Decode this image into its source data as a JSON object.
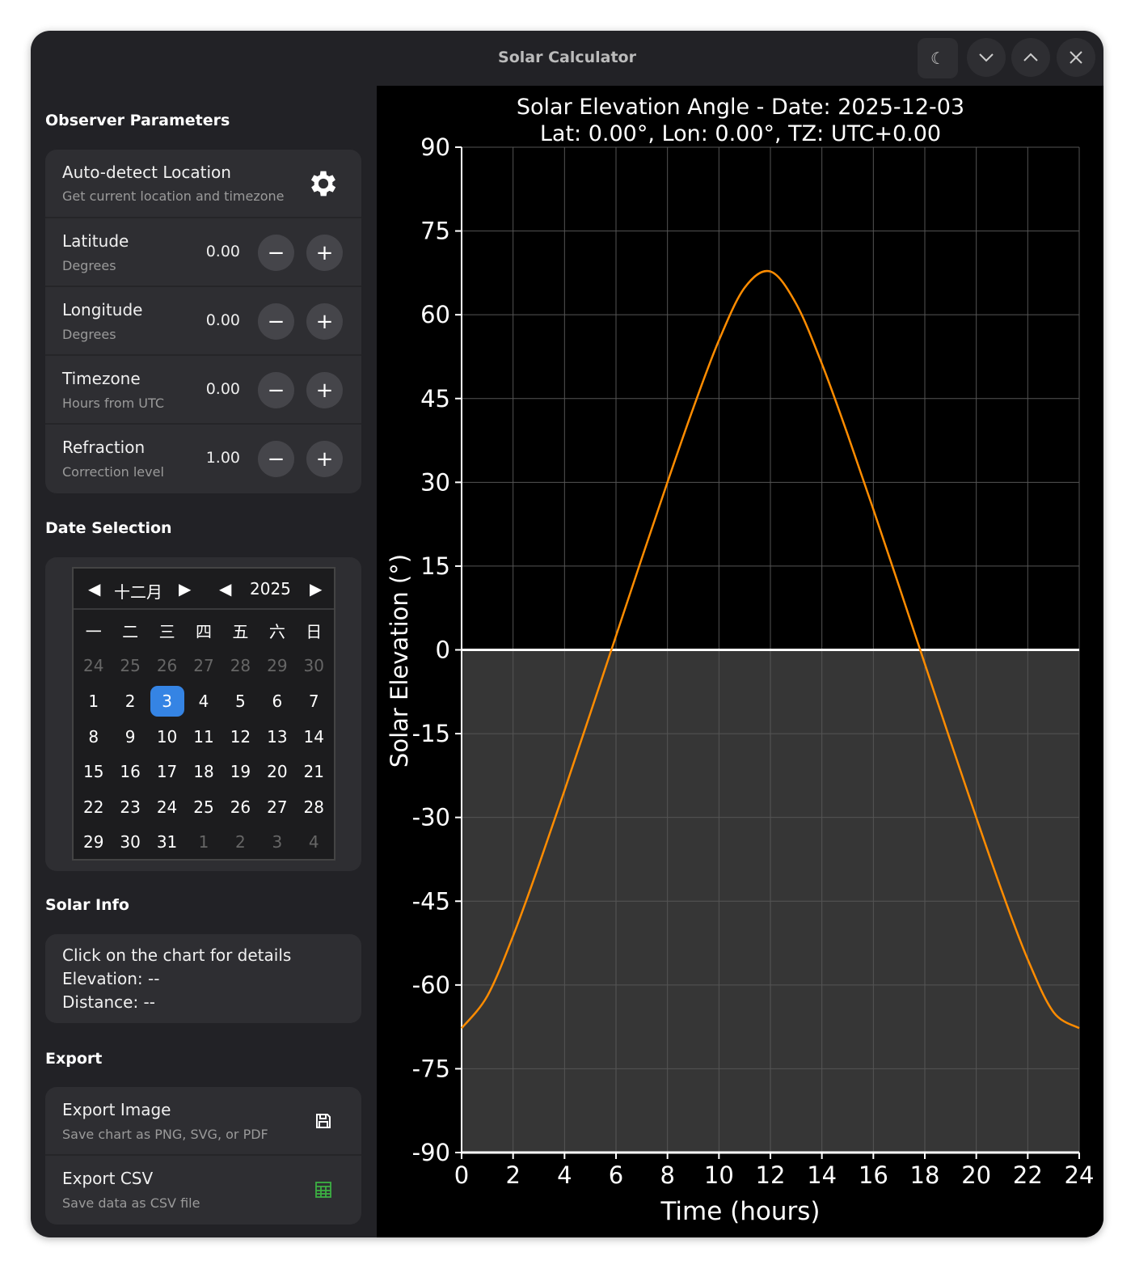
{
  "window": {
    "title": "Solar Calculator"
  },
  "sections": {
    "observer": "Observer Parameters",
    "date": "Date Selection",
    "solar": "Solar Info",
    "export": "Export"
  },
  "autodetect": {
    "label": "Auto-detect Location",
    "sub": "Get current location and timezone"
  },
  "params": [
    {
      "label": "Latitude",
      "sub": "Degrees",
      "value": "0.00"
    },
    {
      "label": "Longitude",
      "sub": "Degrees",
      "value": "0.00"
    },
    {
      "label": "Timezone",
      "sub": "Hours from UTC",
      "value": "0.00"
    },
    {
      "label": "Refraction",
      "sub": "Correction level",
      "value": "1.00"
    }
  ],
  "calendar": {
    "month": "十二月",
    "year": "2025",
    "weekdays": [
      "一",
      "二",
      "三",
      "四",
      "五",
      "六",
      "日"
    ],
    "days": [
      "24",
      "25",
      "26",
      "27",
      "28",
      "29",
      "30",
      "1",
      "2",
      "3",
      "4",
      "5",
      "6",
      "7",
      "8",
      "9",
      "10",
      "11",
      "12",
      "13",
      "14",
      "15",
      "16",
      "17",
      "18",
      "19",
      "20",
      "21",
      "22",
      "23",
      "24",
      "25",
      "26",
      "27",
      "28",
      "29",
      "30",
      "31",
      "1",
      "2",
      "3",
      "4"
    ],
    "selected": "3"
  },
  "solar_info": {
    "line1": "Click on the chart for details",
    "line2": "Elevation: --",
    "line3": "Distance: --"
  },
  "exports": [
    {
      "label": "Export Image",
      "sub": "Save chart as PNG, SVG, or PDF",
      "icon": "save-icon"
    },
    {
      "label": "Export CSV",
      "sub": "Save data as CSV file",
      "icon": "table-icon"
    }
  ],
  "chart_data": {
    "type": "line",
    "title": "Solar Elevation Angle - Date: 2025-12-03",
    "subtitle": "Lat: 0.00°, Lon: 0.00°, TZ: UTC+0.00",
    "xlabel": "Time (hours)",
    "ylabel": "Solar Elevation (°)",
    "xlim": [
      0,
      24
    ],
    "ylim": [
      -90,
      90
    ],
    "xticks": [
      0,
      2,
      4,
      6,
      8,
      10,
      12,
      14,
      16,
      18,
      20,
      22,
      24
    ],
    "yticks": [
      90,
      75,
      60,
      45,
      30,
      15,
      0,
      -15,
      -30,
      -45,
      -60,
      -75,
      -90
    ],
    "grid": true,
    "series": [
      {
        "name": "Solar elevation",
        "color": "#ff8c00",
        "x": [
          0,
          1,
          2,
          3,
          4,
          5,
          6,
          7,
          8,
          9,
          10,
          11,
          12,
          13,
          14,
          15,
          16,
          17,
          18,
          19,
          20,
          21,
          22,
          23,
          24
        ],
        "y": [
          -67.74,
          -61.97,
          -51.23,
          -38.57,
          -25.15,
          -11.38,
          2.5,
          16.36,
          30.03,
          43.26,
          55.42,
          64.85,
          67.74,
          61.97,
          51.23,
          38.57,
          25.15,
          11.38,
          -2.5,
          -16.36,
          -30.03,
          -43.26,
          -55.42,
          -64.85,
          -67.74
        ]
      }
    ]
  }
}
